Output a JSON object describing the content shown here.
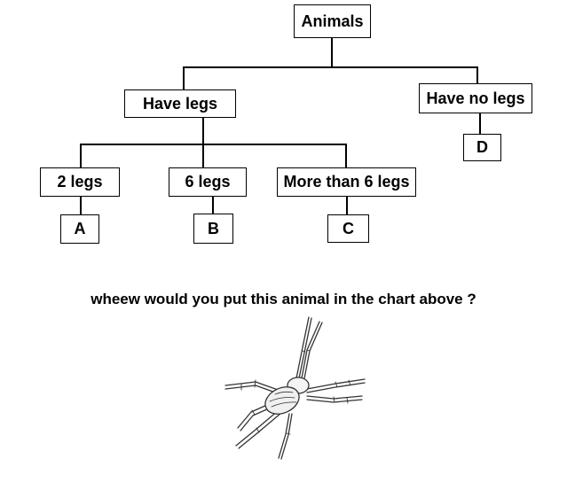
{
  "tree": {
    "root": "Animals",
    "have_legs": "Have legs",
    "have_no_legs": "Have no legs",
    "two_legs": "2 legs",
    "six_legs": "6 legs",
    "more_than_six": "More than 6 legs",
    "leaf_a": "A",
    "leaf_b": "B",
    "leaf_c": "C",
    "leaf_d": "D"
  },
  "question": "wheew would you put this animal in the chart above ?",
  "illustration": {
    "icon": "spider-icon"
  }
}
